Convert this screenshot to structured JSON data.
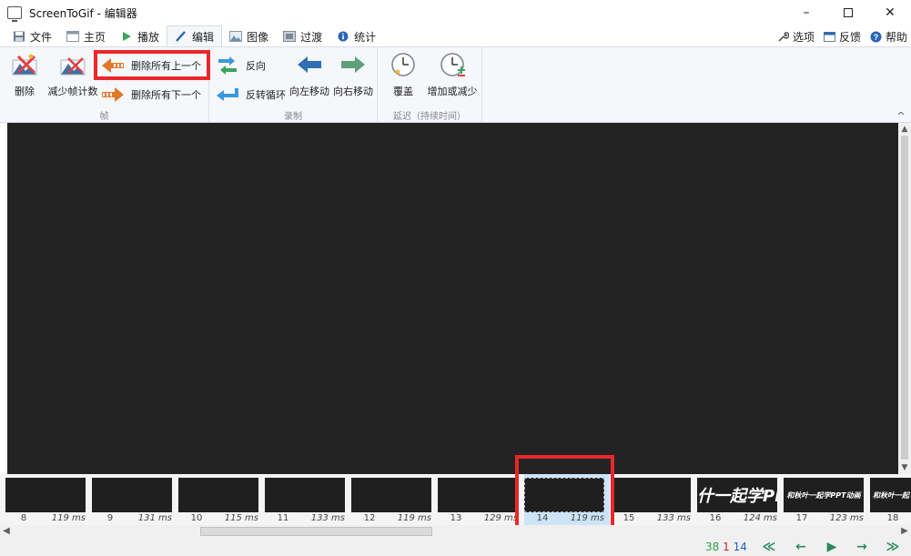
{
  "window": {
    "title": "ScreenToGif - 编辑器",
    "controls": [
      "minimize-icon",
      "maximize-icon",
      "close-icon"
    ]
  },
  "tabs": [
    {
      "label": "文件",
      "icon": "save-icon"
    },
    {
      "label": "主页",
      "icon": "home-icon"
    },
    {
      "label": "播放",
      "icon": "play-icon"
    },
    {
      "label": "编辑",
      "icon": "pencil-icon",
      "active": true
    },
    {
      "label": "图像",
      "icon": "image-icon"
    },
    {
      "label": "过渡",
      "icon": "transition-icon"
    },
    {
      "label": "统计",
      "icon": "info-icon"
    }
  ],
  "top_right": {
    "options": "选项",
    "feedback": "反馈",
    "help": "帮助"
  },
  "ribbon": {
    "frames_group": {
      "label": "帧",
      "delete": "删除",
      "reduce_frame_count": "减少帧计数",
      "delete_all_previous": "删除所有上一个",
      "delete_all_next": "删除所有下一个"
    },
    "recording_group": {
      "label": "录制",
      "reverse": "反向",
      "yoyo": "反转循环",
      "move_left": "向左移动",
      "move_right": "向右移动"
    },
    "delay_group": {
      "label": "延迟（持续时间）",
      "override": "覆盖",
      "increase_decrease": "增加或减少"
    }
  },
  "frames": [
    {
      "num": "8",
      "ms": "119 ms",
      "caption": ""
    },
    {
      "num": "9",
      "ms": "131 ms",
      "caption": ""
    },
    {
      "num": "10",
      "ms": "115 ms",
      "caption": ""
    },
    {
      "num": "11",
      "ms": "133 ms",
      "caption": ""
    },
    {
      "num": "12",
      "ms": "119 ms",
      "caption": ""
    },
    {
      "num": "13",
      "ms": "129 ms",
      "caption": ""
    },
    {
      "num": "14",
      "ms": "119 ms",
      "caption": "",
      "selected": true
    },
    {
      "num": "15",
      "ms": "133 ms",
      "caption": ""
    },
    {
      "num": "16",
      "ms": "124 ms",
      "caption": "什一起学PP"
    },
    {
      "num": "17",
      "ms": "123 ms",
      "caption": "和秋叶一起学PPT动画"
    },
    {
      "num": "18",
      "ms": "",
      "caption": "和秋叶一起"
    }
  ],
  "status": {
    "total_frames": "38",
    "selected_count": "1",
    "current_frame": "14",
    "colors": {
      "total": "#2e9e4b",
      "selected": "#d2232a",
      "current": "#1f66b8"
    }
  },
  "colors": {
    "highlight": "#e8282b",
    "canvas": "#232323",
    "nav_green": "#2b8a5e"
  }
}
